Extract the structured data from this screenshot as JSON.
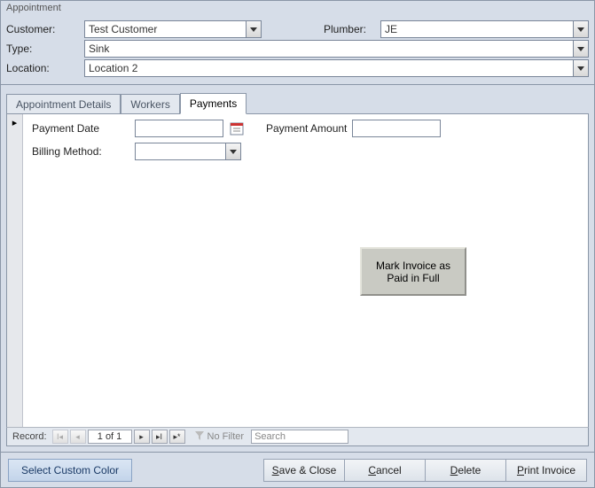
{
  "window_title": "Appointment",
  "header": {
    "customer_label": "Customer:",
    "customer_value": "Test Customer",
    "plumber_label": "Plumber:",
    "plumber_value": "JE",
    "type_label": "Type:",
    "type_value": "Sink",
    "location_label": "Location:",
    "location_value": "Location 2"
  },
  "tabs": {
    "appointment_details": "Appointment Details",
    "workers": "Workers",
    "payments": "Payments"
  },
  "payments_panel": {
    "payment_date_label": "Payment Date",
    "payment_date_value": "",
    "payment_amount_label": "Payment Amount",
    "payment_amount_value": "",
    "billing_method_label": "Billing Method:",
    "billing_method_value": "",
    "mark_paid_label": "Mark Invoice as Paid in Full"
  },
  "record_nav": {
    "label": "Record:",
    "position": "1 of 1",
    "no_filter": "No Filter",
    "search_placeholder": "Search"
  },
  "bottom": {
    "custom_color": "Select Custom Color",
    "save_close_pre": "S",
    "save_close_post": "ave & Close",
    "cancel_pre": "C",
    "cancel_post": "ancel",
    "delete_pre": "D",
    "delete_post": "elete",
    "print_pre": "P",
    "print_post": "rint Invoice"
  }
}
